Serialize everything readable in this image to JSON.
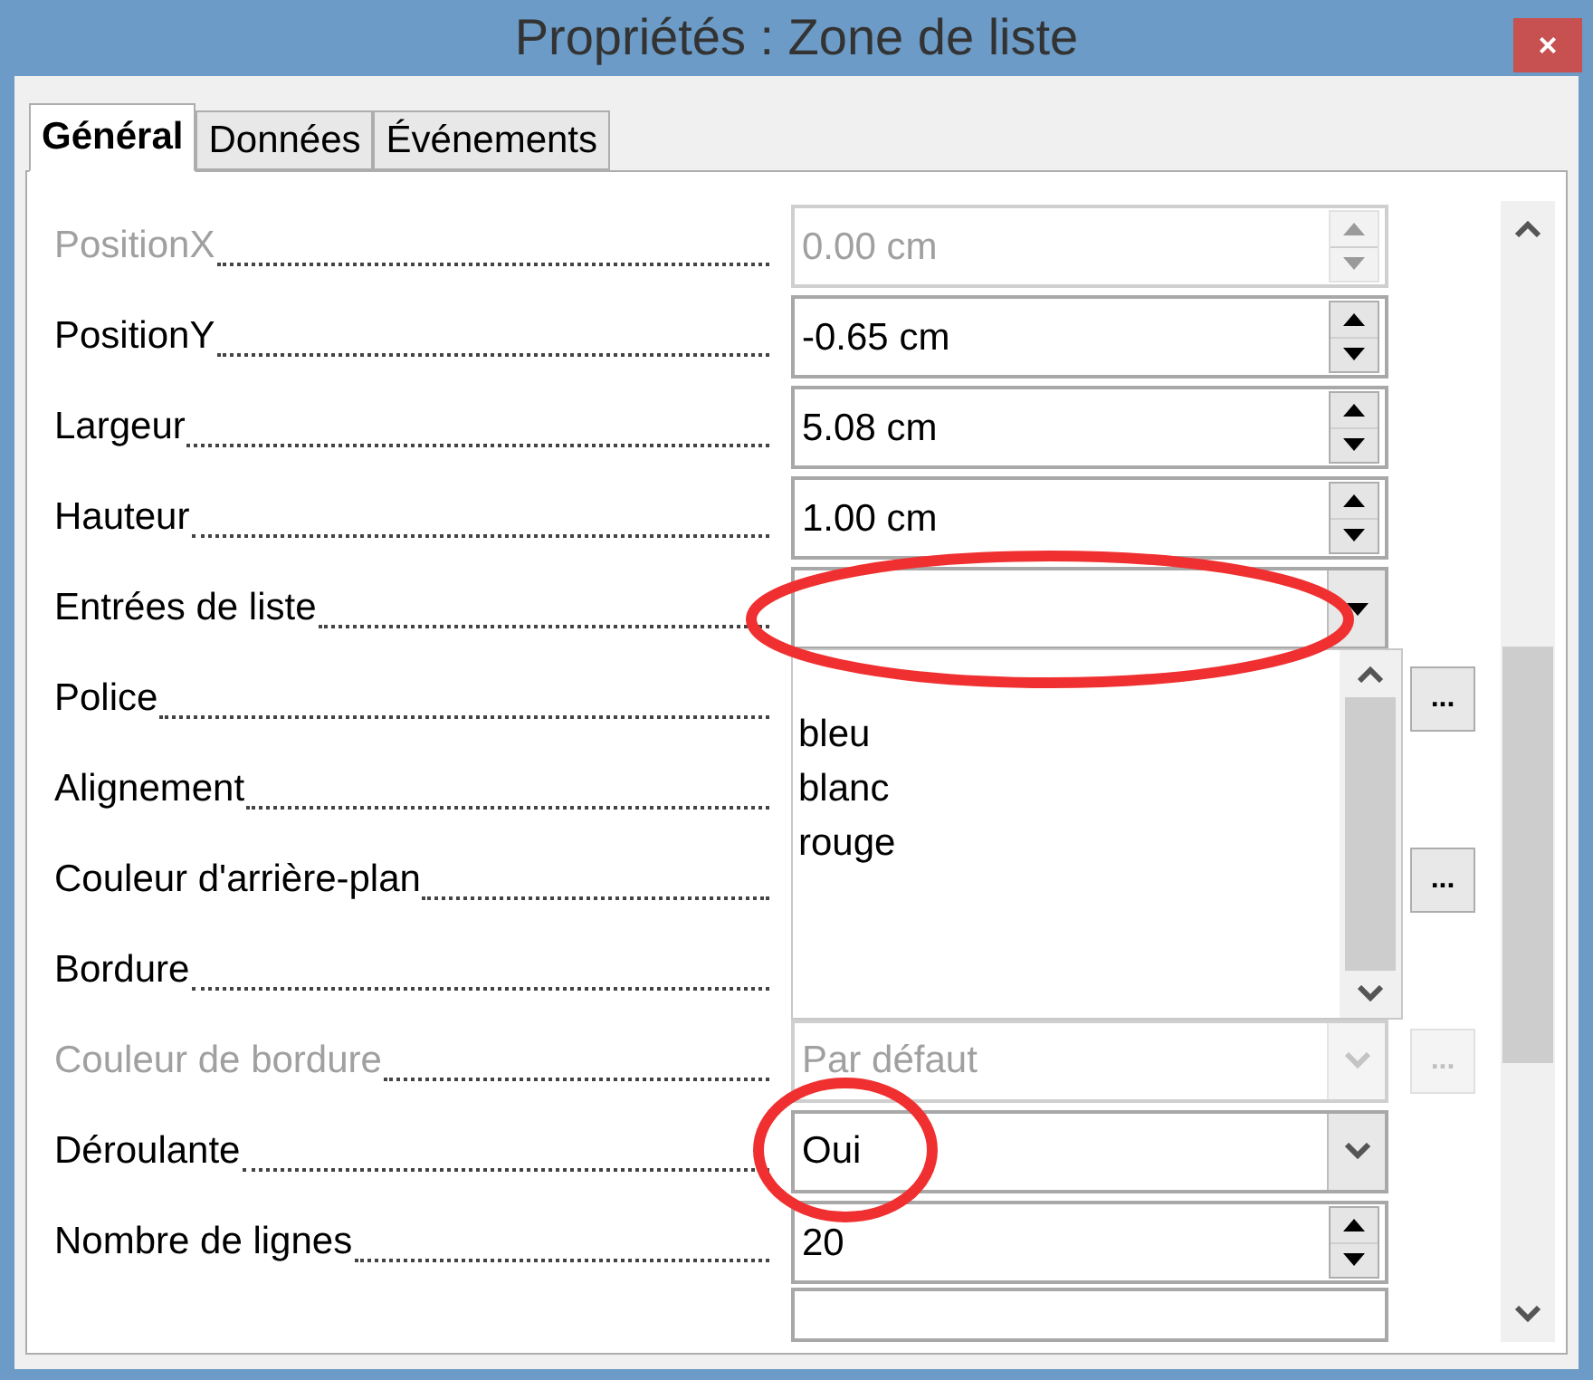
{
  "window": {
    "title": "Propriétés : Zone de liste",
    "close": "×"
  },
  "tabs": [
    {
      "label": "Général",
      "selected": true
    },
    {
      "label": "Données",
      "selected": false
    },
    {
      "label": "Événements",
      "selected": false
    }
  ],
  "rows": [
    {
      "label": "PositionX",
      "kind": "spin",
      "value": "0.00 cm",
      "disabled": true
    },
    {
      "label": "PositionY",
      "kind": "spin",
      "value": "-0.65 cm",
      "disabled": false
    },
    {
      "label": "Largeur",
      "kind": "spin",
      "value": "5.08 cm",
      "disabled": false
    },
    {
      "label": "Hauteur",
      "kind": "spin",
      "value": "1.00 cm",
      "disabled": false
    },
    {
      "label": "Entrées de liste",
      "kind": "combo",
      "disabled": false,
      "expanded": true,
      "options": [
        "bleu",
        "blanc",
        "rouge"
      ]
    },
    {
      "label": "Police",
      "kind": "none",
      "disabled": false,
      "button": {
        "label": "...",
        "disabled": false
      }
    },
    {
      "label": "Alignement",
      "kind": "none",
      "disabled": false
    },
    {
      "label": "Couleur d'arrière-plan",
      "kind": "none",
      "disabled": false,
      "button": {
        "label": "...",
        "disabled": false
      }
    },
    {
      "label": "Bordure",
      "kind": "none",
      "disabled": false
    },
    {
      "label": "Couleur de bordure",
      "kind": "select",
      "value": "Par défaut",
      "disabled": true,
      "button": {
        "label": "...",
        "disabled": true
      }
    },
    {
      "label": "Déroulante",
      "kind": "select",
      "value": "Oui",
      "disabled": false
    },
    {
      "label": "Nombre de lignes",
      "kind": "spin",
      "value": "20",
      "disabled": false
    }
  ],
  "annotations": [
    {
      "kind": "ellipse"
    },
    {
      "kind": "circle"
    }
  ]
}
